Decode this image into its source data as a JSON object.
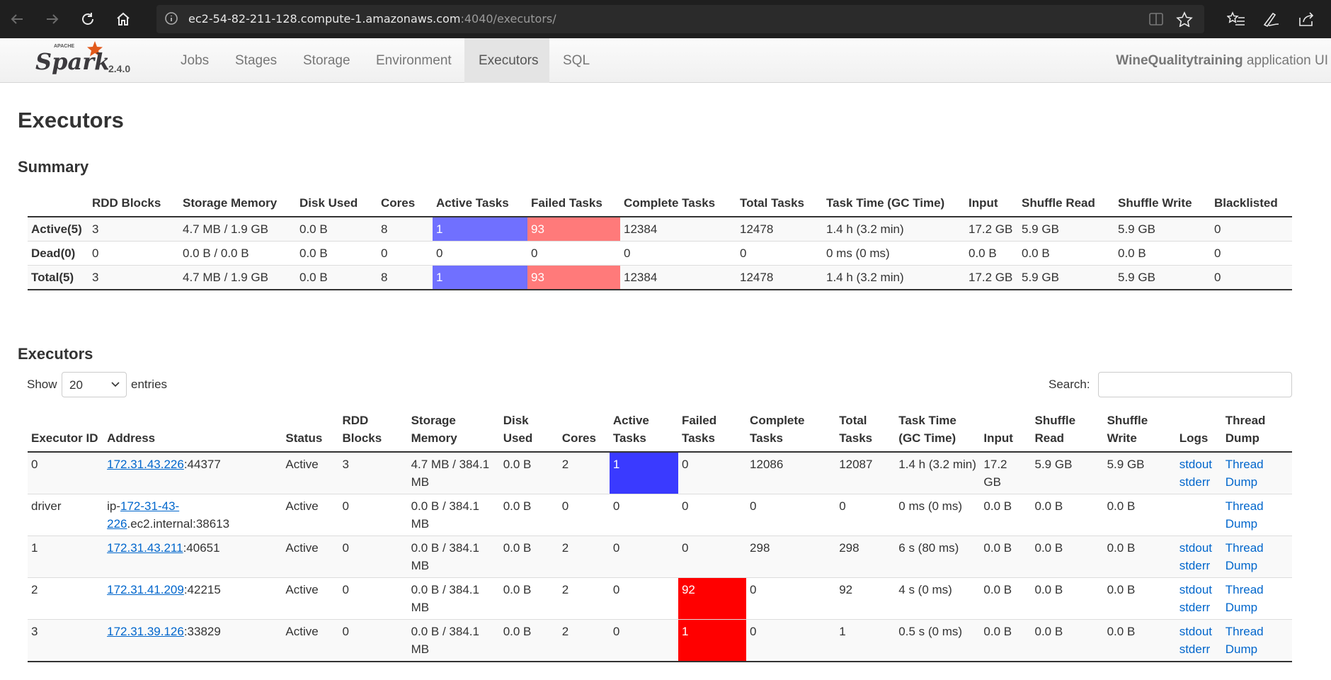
{
  "browser": {
    "url_host": "ec2-54-82-211-128.compute-1.amazonaws.com",
    "url_rest": ":4040/executors/"
  },
  "navbar": {
    "version": "2.4.0",
    "tabs": [
      {
        "label": "Jobs",
        "active": false
      },
      {
        "label": "Stages",
        "active": false
      },
      {
        "label": "Storage",
        "active": false
      },
      {
        "label": "Environment",
        "active": false
      },
      {
        "label": "Executors",
        "active": true
      },
      {
        "label": "SQL",
        "active": false
      }
    ],
    "app_name": "WineQualitytraining",
    "app_suffix": " application UI"
  },
  "page_title": "Executors",
  "summary": {
    "heading": "Summary",
    "headers": [
      "",
      "RDD Blocks",
      "Storage Memory",
      "Disk Used",
      "Cores",
      "Active Tasks",
      "Failed Tasks",
      "Complete Tasks",
      "Total Tasks",
      "Task Time (GC Time)",
      "Input",
      "Shuffle Read",
      "Shuffle Write",
      "Blacklisted"
    ],
    "rows": [
      [
        "Active(5)",
        "3",
        "4.7 MB / 1.9 GB",
        "0.0 B",
        "8",
        "1",
        "93",
        "12384",
        "12478",
        "1.4 h (3.2 min)",
        "17.2 GB",
        "5.9 GB",
        "5.9 GB",
        "0"
      ],
      [
        "Dead(0)",
        "0",
        "0.0 B / 0.0 B",
        "0.0 B",
        "0",
        "0",
        "0",
        "0",
        "0",
        "0 ms (0 ms)",
        "0.0 B",
        "0.0 B",
        "0.0 B",
        "0"
      ],
      [
        "Total(5)",
        "3",
        "4.7 MB / 1.9 GB",
        "0.0 B",
        "8",
        "1",
        "93",
        "12384",
        "12478",
        "1.4 h (3.2 min)",
        "17.2 GB",
        "5.9 GB",
        "5.9 GB",
        "0"
      ]
    ]
  },
  "executors": {
    "heading": "Executors",
    "show_label": "Show",
    "page_size": "20",
    "entries_label": "entries",
    "search_label": "Search:",
    "search_value": "",
    "headers": [
      "Executor ID",
      "Address",
      "Status",
      "RDD Blocks",
      "Storage Memory",
      "Disk Used",
      "Cores",
      "Active Tasks",
      "Failed Tasks",
      "Complete Tasks",
      "Total Tasks",
      "Task Time (GC Time)",
      "Input",
      "Shuffle Read",
      "Shuffle Write",
      "Logs",
      "Thread Dump"
    ],
    "rows": [
      {
        "id": "0",
        "addr_link": "172.31.43.226",
        "addr_tail": ":44377",
        "status": "Active",
        "rdd": "3",
        "mem": "4.7 MB / 384.1 MB",
        "disk": "0.0 B",
        "cores": "2",
        "active": "1",
        "failed": "0",
        "complete": "12086",
        "total": "12087",
        "time": "1.4 h (3.2 min)",
        "input": "17.2 GB",
        "sread": "5.9 GB",
        "swrite": "5.9 GB",
        "logs": [
          "stdout",
          "stderr"
        ],
        "dump": "Thread Dump"
      },
      {
        "id": "driver",
        "addr_pre": "ip-",
        "addr_link": "172-31-43-226",
        "addr_tail": ".ec2.internal:38613",
        "status": "Active",
        "rdd": "0",
        "mem": "0.0 B / 384.1 MB",
        "disk": "0.0 B",
        "cores": "0",
        "active": "0",
        "failed": "0",
        "complete": "0",
        "total": "0",
        "time": "0 ms (0 ms)",
        "input": "0.0 B",
        "sread": "0.0 B",
        "swrite": "0.0 B",
        "logs": [],
        "dump": "Thread Dump"
      },
      {
        "id": "1",
        "addr_link": "172.31.43.211",
        "addr_tail": ":40651",
        "status": "Active",
        "rdd": "0",
        "mem": "0.0 B / 384.1 MB",
        "disk": "0.0 B",
        "cores": "2",
        "active": "0",
        "failed": "0",
        "complete": "298",
        "total": "298",
        "time": "6 s (80 ms)",
        "input": "0.0 B",
        "sread": "0.0 B",
        "swrite": "0.0 B",
        "logs": [
          "stdout",
          "stderr"
        ],
        "dump": "Thread Dump"
      },
      {
        "id": "2",
        "addr_link": "172.31.41.209",
        "addr_tail": ":42215",
        "status": "Active",
        "rdd": "0",
        "mem": "0.0 B / 384.1 MB",
        "disk": "0.0 B",
        "cores": "2",
        "active": "0",
        "failed": "92",
        "complete": "0",
        "total": "92",
        "time": "4 s (0 ms)",
        "input": "0.0 B",
        "sread": "0.0 B",
        "swrite": "0.0 B",
        "logs": [
          "stdout",
          "stderr"
        ],
        "dump": "Thread Dump"
      },
      {
        "id": "3",
        "addr_link": "172.31.39.126",
        "addr_tail": ":33829",
        "status": "Active",
        "rdd": "0",
        "mem": "0.0 B / 384.1 MB",
        "disk": "0.0 B",
        "cores": "2",
        "active": "0",
        "failed": "1",
        "complete": "0",
        "total": "1",
        "time": "0.5 s (0 ms)",
        "input": "0.0 B",
        "sread": "0.0 B",
        "swrite": "0.0 B",
        "logs": [
          "stdout",
          "stderr"
        ],
        "dump": "Thread Dump"
      }
    ]
  },
  "colors": {
    "summary_active_fill": "#7070ff",
    "summary_failed_fill": "#ff7a7a",
    "exec_active_fill": "#3a3aff",
    "exec_failed_fill": "#ff0000"
  }
}
